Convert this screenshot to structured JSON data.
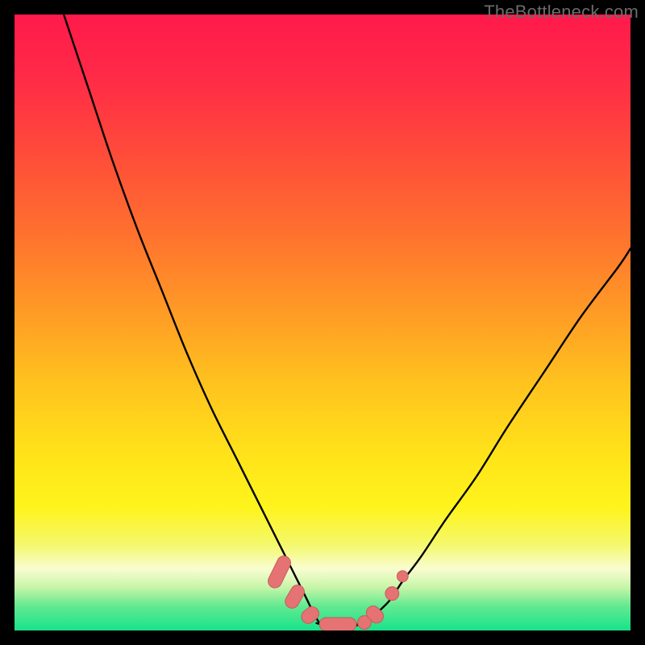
{
  "watermark": "TheBottleneck.com",
  "colors": {
    "gradient_stops": [
      {
        "offset": 0.0,
        "color": "#ff1a4b"
      },
      {
        "offset": 0.1,
        "color": "#ff2a47"
      },
      {
        "offset": 0.22,
        "color": "#ff4a3a"
      },
      {
        "offset": 0.35,
        "color": "#ff6f2f"
      },
      {
        "offset": 0.48,
        "color": "#ff9a26"
      },
      {
        "offset": 0.6,
        "color": "#ffc31e"
      },
      {
        "offset": 0.72,
        "color": "#ffe41a"
      },
      {
        "offset": 0.8,
        "color": "#fff41c"
      },
      {
        "offset": 0.86,
        "color": "#f4f86b"
      },
      {
        "offset": 0.9,
        "color": "#f9fdd0"
      },
      {
        "offset": 0.93,
        "color": "#c7f5a8"
      },
      {
        "offset": 0.96,
        "color": "#63e991"
      },
      {
        "offset": 1.0,
        "color": "#17e38a"
      }
    ],
    "curve": "#000000",
    "marker_fill": "#e57373",
    "marker_stroke": "#c85a5a",
    "frame": "#000000"
  },
  "chart_data": {
    "type": "line",
    "title": "",
    "xlabel": "",
    "ylabel": "",
    "xlim": [
      0,
      100
    ],
    "ylim": [
      0,
      100
    ],
    "grid": false,
    "legend": false,
    "series": [
      {
        "name": "left-curve",
        "x": [
          8,
          12,
          16,
          20,
          24,
          28,
          32,
          36,
          40,
          43,
          45,
          47,
          49,
          50,
          52
        ],
        "y": [
          100,
          88,
          76,
          65,
          55,
          45,
          36,
          28,
          20,
          14,
          10,
          6,
          2,
          1,
          0.8
        ]
      },
      {
        "name": "right-curve",
        "x": [
          55,
          57,
          59,
          61,
          63,
          66,
          70,
          75,
          80,
          86,
          92,
          98,
          100
        ],
        "y": [
          0.8,
          1.5,
          3,
          5,
          8,
          12,
          18,
          25,
          33,
          42,
          51,
          59,
          62
        ]
      },
      {
        "name": "valley-floor",
        "x": [
          49,
          50,
          51,
          52,
          53,
          54,
          55,
          56,
          57,
          58
        ],
        "y": [
          1.2,
          0.9,
          0.8,
          0.8,
          0.8,
          0.8,
          0.8,
          0.9,
          1.2,
          2.0
        ]
      }
    ],
    "markers": [
      {
        "shape": "pill",
        "x": 43.0,
        "y": 9.5,
        "angle": -64,
        "len": 5.5
      },
      {
        "shape": "pill",
        "x": 45.5,
        "y": 5.5,
        "angle": -60,
        "len": 4.0
      },
      {
        "shape": "pill",
        "x": 48.0,
        "y": 2.5,
        "angle": -40,
        "len": 3.0
      },
      {
        "shape": "pill",
        "x": 52.5,
        "y": 1.0,
        "angle": 0,
        "len": 6.0
      },
      {
        "shape": "circle",
        "x": 56.8,
        "y": 1.3,
        "r": 1.1
      },
      {
        "shape": "pill",
        "x": 58.5,
        "y": 2.6,
        "angle": 45,
        "len": 3.0
      },
      {
        "shape": "circle",
        "x": 61.3,
        "y": 6.0,
        "r": 1.1
      },
      {
        "shape": "circle",
        "x": 63.0,
        "y": 8.8,
        "r": 0.9
      }
    ]
  }
}
